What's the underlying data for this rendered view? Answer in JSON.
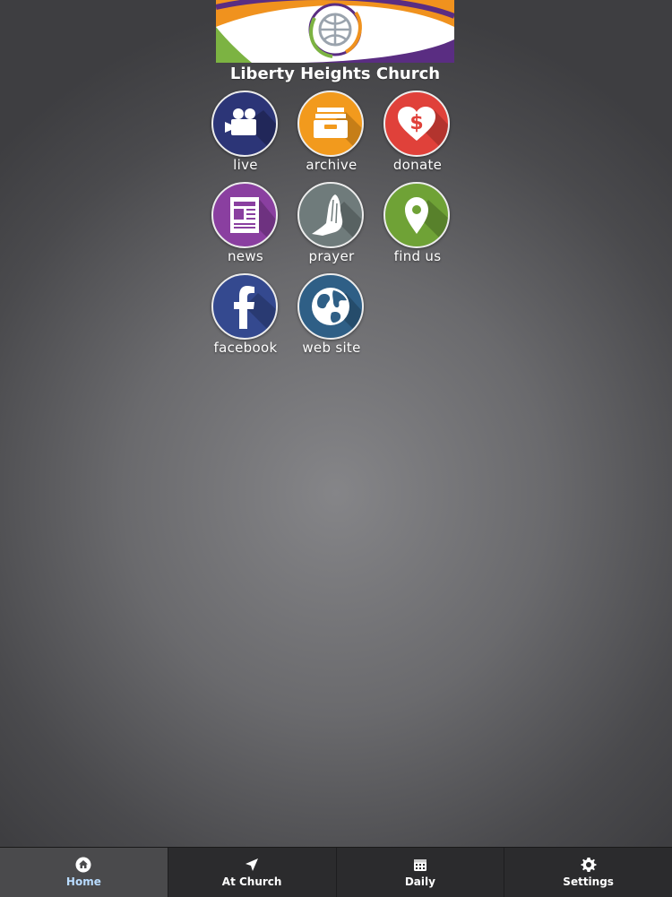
{
  "header": {
    "church_name": "Liberty Heights Church"
  },
  "tiles": [
    {
      "label": "live",
      "icon": "video-camera-icon",
      "color": "#2c3577"
    },
    {
      "label": "archive",
      "icon": "archive-drawer-icon",
      "color": "#f29a1d"
    },
    {
      "label": "donate",
      "icon": "heart-dollar-icon",
      "color": "#e0413a"
    },
    {
      "label": "news",
      "icon": "newspaper-icon",
      "color": "#8a3fa0"
    },
    {
      "label": "prayer",
      "icon": "praying-hands-icon",
      "color": "#6f7b7b"
    },
    {
      "label": "find us",
      "icon": "map-pin-icon",
      "color": "#6fa236"
    },
    {
      "label": "facebook",
      "icon": "facebook-icon",
      "color": "#34498f"
    },
    {
      "label": "web site",
      "icon": "globe-icon",
      "color": "#2f5f86"
    }
  ],
  "tabbar": {
    "active": "Home",
    "tabs": [
      {
        "label": "Home",
        "icon": "home-icon"
      },
      {
        "label": "At Church",
        "icon": "location-arrow-icon"
      },
      {
        "label": "Daily",
        "icon": "calendar-icon"
      },
      {
        "label": "Settings",
        "icon": "gear-icon"
      }
    ]
  }
}
